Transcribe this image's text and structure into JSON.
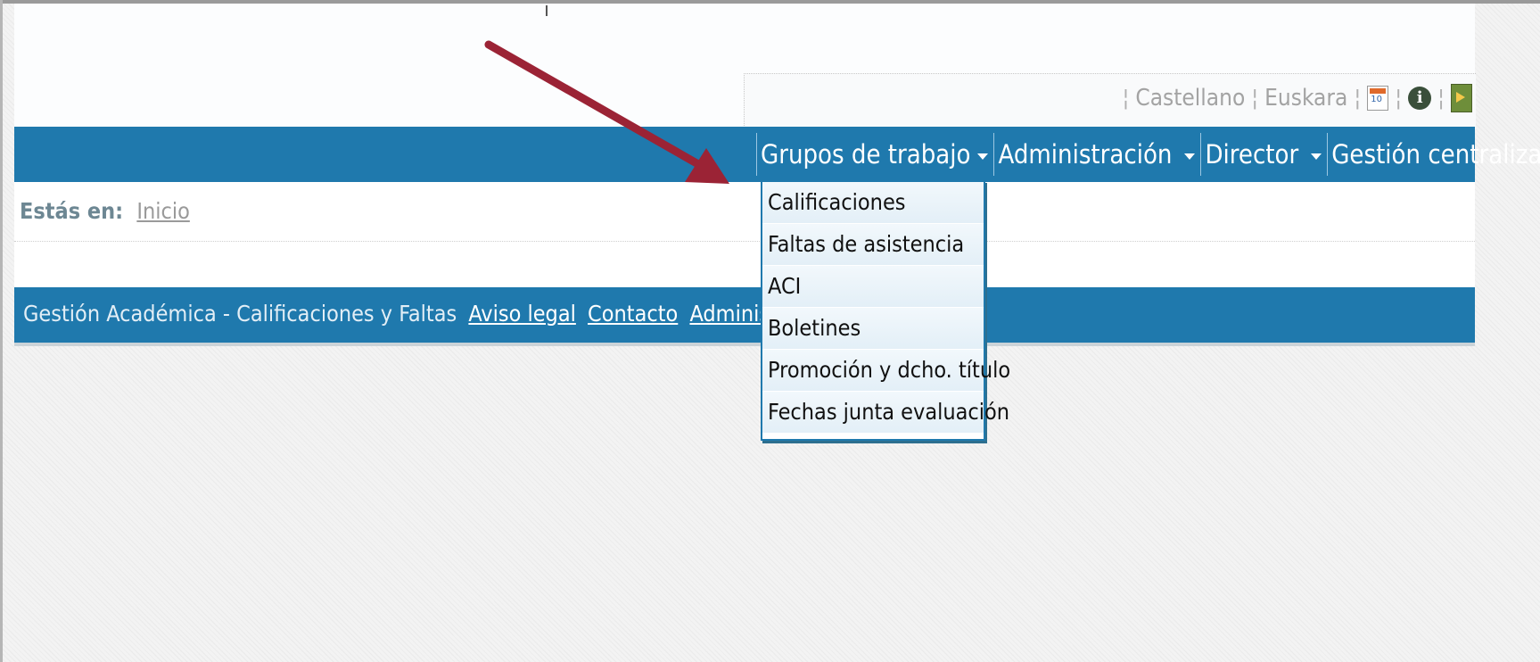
{
  "top_links": {
    "languages": [
      "Castellano",
      "Euskara"
    ],
    "icons": [
      "calendar-icon",
      "info-icon",
      "exit-icon"
    ]
  },
  "nav": {
    "menus": [
      {
        "label": "Grupos de trabajo"
      },
      {
        "label": "Administración"
      },
      {
        "label": "Director"
      },
      {
        "label": "Gestión centralizada"
      }
    ]
  },
  "dropdown": {
    "items": [
      "Calificaciones",
      "Faltas de asistencia",
      "ACI",
      "Boletines",
      "Promoción y dcho. título",
      "Fechas junta evaluación"
    ]
  },
  "breadcrumb": {
    "label": "Estás en:",
    "link": "Inicio"
  },
  "footer": {
    "text": "Gestión Académica - Calificaciones y Faltas",
    "links": [
      "Aviso legal",
      "Contacto",
      "Administración"
    ]
  },
  "colors": {
    "nav_blue": "#1f79ad",
    "annotation_arrow": "#9b2335"
  }
}
